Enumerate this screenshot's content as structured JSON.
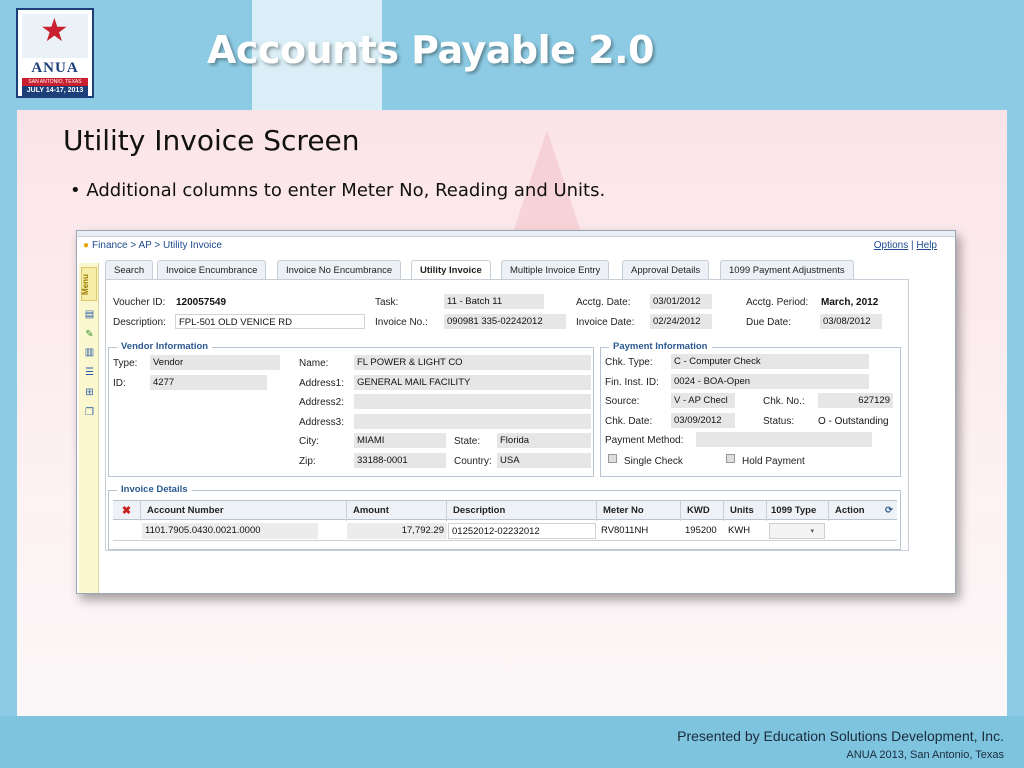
{
  "slide": {
    "title": "Accounts Payable 2.0",
    "subtitle": "Utility Invoice Screen",
    "bullet": "• Additional columns to enter Meter No, Reading and Units.",
    "footer_main": "Presented by Education Solutions Development, Inc.",
    "footer_sub": "ANUA 2013, San Antonio, Texas"
  },
  "logo": {
    "name": "ANUA",
    "location": "SAN ANTONIO, TEXAS",
    "dates": "JULY 14-17, 2013"
  },
  "app": {
    "breadcrumb": "Finance > AP > Utility Invoice",
    "options_link": "Options",
    "help_link": "Help",
    "separator": "|",
    "menu_label": "Menu",
    "tabs": [
      {
        "label": "Search"
      },
      {
        "label": "Invoice Encumbrance"
      },
      {
        "label": "Invoice No Encumbrance"
      },
      {
        "label": "Utility Invoice"
      },
      {
        "label": "Multiple Invoice Entry"
      },
      {
        "label": "Approval Details"
      },
      {
        "label": "1099 Payment Adjustments"
      }
    ],
    "active_tab": "Utility Invoice",
    "header": {
      "voucher_id_label": "Voucher ID:",
      "voucher_id": "120057549",
      "task_label": "Task:",
      "task": "11 - Batch 11",
      "acctg_date_label": "Acctg. Date:",
      "acctg_date": "03/01/2012",
      "acctg_period_label": "Acctg. Period:",
      "acctg_period": "March, 2012",
      "description_label": "Description:",
      "description": "FPL-501 OLD VENICE RD",
      "invoice_no_label": "Invoice No.:",
      "invoice_no": "090981 335-02242012",
      "invoice_date_label": "Invoice Date:",
      "invoice_date": "02/24/2012",
      "due_date_label": "Due Date:",
      "due_date": "03/08/2012"
    },
    "vendor": {
      "legend": "Vendor Information",
      "type_label": "Type:",
      "type": "Vendor",
      "id_label": "ID:",
      "id": "4277",
      "name_label": "Name:",
      "name": "FL POWER & LIGHT CO",
      "address1_label": "Address1:",
      "address1": "GENERAL MAIL FACILITY",
      "address2_label": "Address2:",
      "address2": "",
      "address3_label": "Address3:",
      "address3": "",
      "city_label": "City:",
      "city": "MIAMI",
      "state_label": "State:",
      "state": "Florida",
      "zip_label": "Zip:",
      "zip": "33188-0001",
      "country_label": "Country:",
      "country": "USA"
    },
    "payment": {
      "legend": "Payment Information",
      "chk_type_label": "Chk. Type:",
      "chk_type": "C - Computer Check",
      "fin_inst_label": "Fin. Inst. ID:",
      "fin_inst": "0024 - BOA-Open",
      "source_label": "Source:",
      "source": "V - AP Checl",
      "chk_no_label": "Chk. No.:",
      "chk_no": "627129",
      "chk_date_label": "Chk. Date:",
      "chk_date": "03/09/2012",
      "status_label": "Status:",
      "status": "O - Outstanding",
      "payment_method_label": "Payment Method:",
      "payment_method": "",
      "single_check_label": "Single Check",
      "hold_payment_label": "Hold Payment"
    },
    "invoice_details": {
      "legend": "Invoice Details",
      "columns": [
        "Account Number",
        "Amount",
        "Description",
        "Meter No",
        "KWD",
        "Units",
        "1099 Type",
        "Action"
      ],
      "rows": [
        {
          "account_number": "1101.7905.0430.0021.0000",
          "amount": "17,792.29",
          "description": "01252012-02232012",
          "meter_no": "RV8011NH",
          "kwd": "195200",
          "units": "KWH",
          "type_1099": "",
          "action": ""
        }
      ]
    }
  }
}
